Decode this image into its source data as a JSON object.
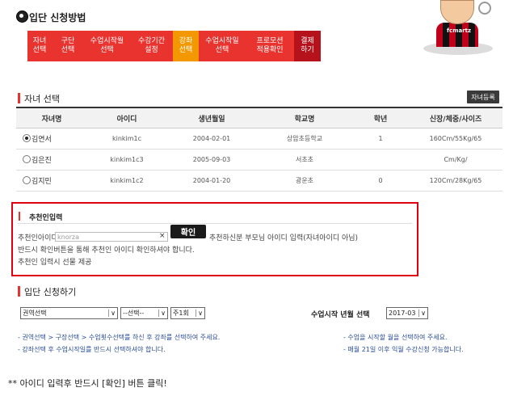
{
  "header": {
    "title": "입단 신청방법"
  },
  "steps": [
    {
      "label": "자녀\n선택"
    },
    {
      "label": "구단\n선택"
    },
    {
      "label": "수업시작월\n선택"
    },
    {
      "label": "수강기간\n설정"
    },
    {
      "label": "강좌\n선택",
      "active": true
    },
    {
      "label": "수업시작일\n선택"
    },
    {
      "label": "프로모션\n적용확인"
    },
    {
      "label": "결제\n하기"
    }
  ],
  "mascot": {
    "jersey_text": "fcmartz"
  },
  "children_section": {
    "title": "자녀 선택",
    "register_button": "자녀등록",
    "columns": [
      "자녀명",
      "아이디",
      "생년월일",
      "학교명",
      "학년",
      "신장/체중/사이즈"
    ],
    "rows": [
      {
        "name": "김연서",
        "id": "kinkim1c",
        "birth": "2004-02-01",
        "school": "상암초등학교",
        "grade": "1",
        "size": "160Cm/55Kg/65",
        "selected": true
      },
      {
        "name": "김은진",
        "id": "kinkim1c3",
        "birth": "2005-09-03",
        "school": "서초초",
        "grade": "",
        "size": "Cm/Kg/",
        "selected": false
      },
      {
        "name": "김지민",
        "id": "kinkim1c2",
        "birth": "2004-01-20",
        "school": "광운초",
        "grade": "0",
        "size": "120Cm/28Kg/65",
        "selected": false
      }
    ]
  },
  "recommender": {
    "title": "추천인입력",
    "id_label": "추천인아이디",
    "input_value": "knorza",
    "clear": "×",
    "confirm_button": "확인",
    "hint": "추천하신분 부모님 아이디 입력(자녀아이디 아님)",
    "notice1": "반드시 확인버튼을 통해 추천인 아이디 확인하셔야 합니다.",
    "notice2": "추천인 입력시 선물 제공"
  },
  "apply_section": {
    "title": "입단 신청하기",
    "select_course": "권역선택",
    "select_option": "--선택--",
    "select_times": "주1회",
    "start_label": "수업시작 년월 선택",
    "start_value": "2017-03"
  },
  "notes": {
    "left1": "- 권역선택 > 구장선택 > 수업횟수선택를 하신 후 강좌를 선택하여 주세요.",
    "left2": "- 강좌선택 후 수업시작일를 반드시 선택하셔야 합니다.",
    "right1": "- 수업을 시작할 월을 선택하여 주세요.",
    "right2": "- 매월 21일 이후 익월 수강신청 가능합니다."
  },
  "footer": {
    "note": "** 아이디 입력후 반드시 [확인] 버튼 클릭!"
  }
}
